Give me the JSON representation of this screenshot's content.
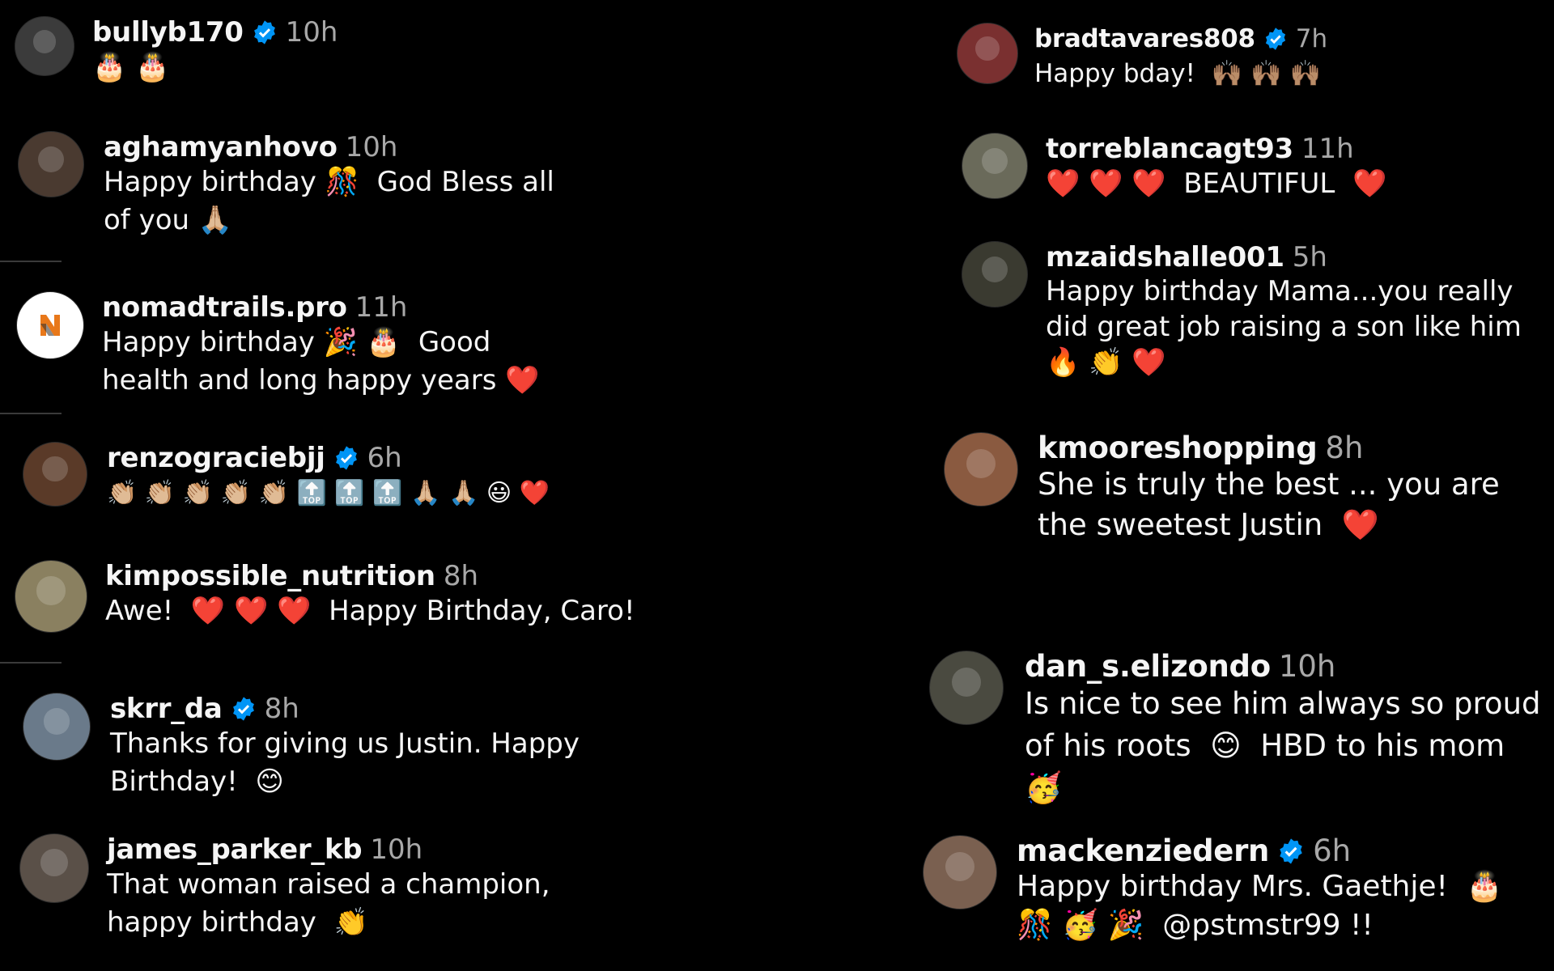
{
  "colors": {
    "background": "#000000",
    "username": "#f5f5f5",
    "time": "#a8a8a8",
    "verified": "#0095f6"
  },
  "comments_left": [
    {
      "user": "bullyb170",
      "verified": true,
      "time": "10h",
      "text": "🎂 🎂",
      "avatar_color": "#3b3b3b"
    },
    {
      "user": "aghamyanhovo",
      "verified": false,
      "time": "10h",
      "text": "Happy birthday 🎊  God Bless all of you 🙏🏼",
      "avatar_color": "#4a3a30"
    },
    {
      "user": "nomadtrails.pro",
      "verified": false,
      "time": "11h",
      "text": "Happy birthday 🎉 🎂  Good health and long happy years ❤️",
      "avatar_color": "#ffffff"
    },
    {
      "user": "renzograciebjj",
      "verified": true,
      "time": "6h",
      "text": "👏🏼 👏🏼 👏🏼 👏🏼 👏🏼 🔝 🔝 🔝 🙏🏼 🙏🏼 😃 ❤️",
      "avatar_color": "#5a3a28"
    },
    {
      "user": "kimpossible_nutrition",
      "verified": false,
      "time": "8h",
      "text": "Awe!  ❤️ ❤️ ❤️  Happy Birthday, Caro!",
      "avatar_color": "#8a8060"
    },
    {
      "user": "skrr_da",
      "verified": true,
      "time": "8h",
      "text": "Thanks for giving us Justin. Happy Birthday!  😊",
      "avatar_color": "#6a7a8a"
    },
    {
      "user": "james_parker_kb",
      "verified": false,
      "time": "10h",
      "text": "That woman raised a champion, happy birthday  👏",
      "avatar_color": "#5a5048"
    }
  ],
  "comments_right": [
    {
      "user": "bradtavares808",
      "verified": true,
      "time": "7h",
      "text": "Happy bday!  🙌🏽 🙌🏽 🙌🏽",
      "avatar_color": "#7a3030"
    },
    {
      "user": "torreblancagt93",
      "verified": false,
      "time": "11h",
      "text": "❤️ ❤️ ❤️  BEAUTIFUL  ❤️",
      "avatar_color": "#6a6a5a"
    },
    {
      "user": "mzaidshalle001",
      "verified": false,
      "time": "5h",
      "text": "Happy birthday Mama...you really did great job raising a son like him 🔥 👏 ❤️",
      "avatar_color": "#3a3a30"
    },
    {
      "user": "kmooreshopping",
      "verified": false,
      "time": "8h",
      "text": "She is truly the best ... you are the sweetest Justin  ❤️",
      "avatar_color": "#8a5a40"
    },
    {
      "user": "dan_s.elizondo",
      "verified": false,
      "time": "10h",
      "text": "Is nice to see him always so proud of his roots  😊  HBD to his mom  🥳",
      "avatar_color": "#4a4a40"
    },
    {
      "user": "mackenziedern",
      "verified": true,
      "time": "6h",
      "text": "Happy birthday Mrs. Gaethje!  🎂 🎊 🥳 🎉  @pstmstr99 !!",
      "avatar_color": "#7a6050"
    }
  ]
}
